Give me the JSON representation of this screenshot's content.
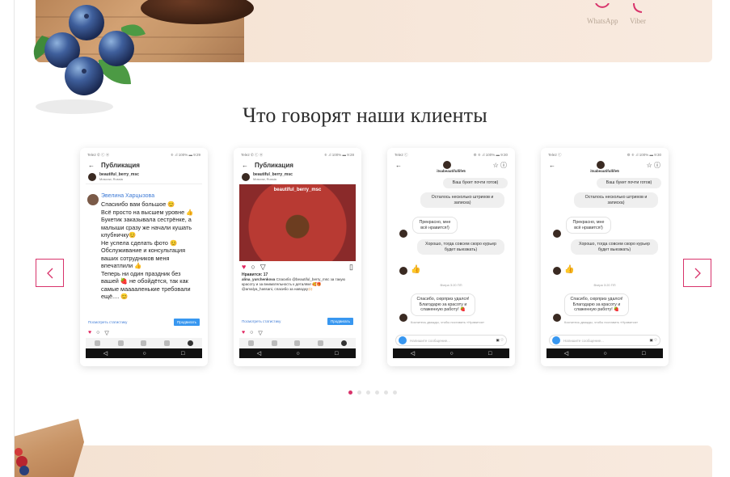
{
  "social": [
    {
      "name": "WhatsApp",
      "icon": "whatsapp-icon"
    },
    {
      "name": "Viber",
      "icon": "viber-icon"
    }
  ],
  "section": {
    "title": "Что говорят наши клиенты"
  },
  "colors": {
    "accent": "#d8336b",
    "instagram_blue": "#3897f0",
    "banner": "#f6e6d9"
  },
  "slider": {
    "prev_icon": "chevron-left-icon",
    "next_icon": "chevron-right-icon",
    "dot_count": 6,
    "active_dot": 0
  },
  "cards": [
    {
      "status_left": "Tele2 ✆ ⓒ ⓦ",
      "status_right": "⁜ .ıl 100% ▬ 9:29",
      "nav_title": "Публикация",
      "user": "beautiful_berry_msc",
      "location": "Moscow, Russia",
      "comment_author": "Эвелина Харцызова",
      "comment": "Спасиибо вам большое 😊\nВсё просто на высшем уровне 👍\nБукетик заказывала сестрёнке, а\nмалыши сразу же начали кушать\nклубничку😊\nНе успела сделать фото 😊\nОбслуживание и консультация\nваших сотрудников меня\nвпечатлили 👍\nТеперь ни один праздник без\nвашей 🍓 не обойдётся, так как\nсамые мааааленькие требовали\nещё.... 😊",
      "stats_link": "Посмотреть статистику",
      "promote": "Продвигать"
    },
    {
      "status_left": "Tele2 ✆ ⓒ ⓦ",
      "status_right": "⁜ .ıl 100% ▬ 9:28",
      "nav_title": "Публикация",
      "user": "beautiful_berry_msc",
      "location": "Moscow, Russia",
      "photo_tag": "beautiful_berry_msc",
      "likes": "Нравится: 17",
      "caption_user": "alina_yurchenkova",
      "caption": "Спасибо @beautiful_berry_msc за такую красоту и за внимательность к деталям! 🥰🎁 @amalya_hassani, спасибо за наводку🙌🏻",
      "stats_link": "Посмотреть статистику",
      "promote": "Продвигать"
    },
    {
      "status_left": "Tele2 ⓒ",
      "status_right": "⚙ ⁜ .ıl 100% ▬ 9:30",
      "profile": "itsabeautifullife5",
      "messages": [
        "Ваш букет почти готов)",
        "Осталось несколько штрихов и записка)",
        "Прекрасно, мне всё нравится!)",
        "Хорошо, тогда совсем скоро курьер будет выезжать)",
        "Вчера 3:20 ПП",
        "Спасибо, сюрприз удался! Благодарю за красоту и слаженную работу! 🍓",
        "Коснитесь дважды, чтобы поставить «Нравится»"
      ],
      "input_placeholder": "Напишите сообщение..."
    },
    {
      "status_left": "Tele2 ⓒ",
      "status_right": "⚙ ⁜ .ıl 100% ▬ 9:30",
      "profile": "itsabeautifullife5",
      "messages": [
        "Ваш букет почти готов)",
        "Осталось несколько штрихов и записка)",
        "Прекрасно, мне всё нравится!)",
        "Хорошо, тогда совсем скоро курьер будет выезжать)",
        "Вчера 3:20 ПП",
        "Спасибо, сюрприз удался! Благодарю за красоту и слаженную работу! 🍓",
        "Коснитесь дважды, чтобы поставить «Нравится»"
      ],
      "input_placeholder": "Напишите сообщение..."
    }
  ]
}
